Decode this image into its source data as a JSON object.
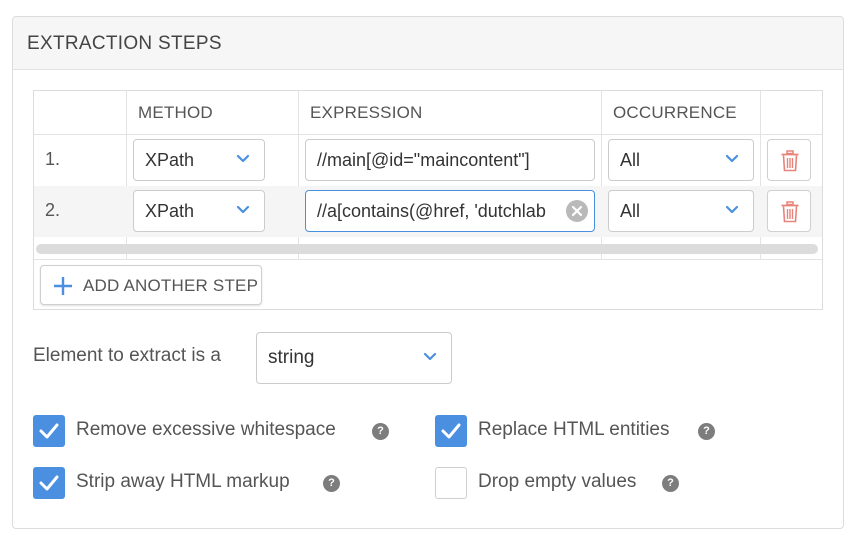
{
  "panel": {
    "title": "EXTRACTION STEPS"
  },
  "table": {
    "headers": {
      "method": "METHOD",
      "expression": "EXPRESSION",
      "occurrence": "OCCURRENCE"
    },
    "rows": [
      {
        "num": "1.",
        "method": "XPath",
        "expression": "//main[@id=\"maincontent\"]",
        "occurrence": "All"
      },
      {
        "num": "2.",
        "method": "XPath",
        "expression": "//a[contains(@href, 'dutchlab",
        "occurrence": "All"
      }
    ],
    "add_button_label": "ADD ANOTHER STEP"
  },
  "extract": {
    "label": "Element to extract is a",
    "type": "string"
  },
  "options": [
    {
      "label": "Remove excessive whitespace",
      "checked": true,
      "help": "?"
    },
    {
      "label": "Replace HTML entities",
      "checked": true,
      "help": "?"
    },
    {
      "label": "Strip away HTML markup",
      "checked": true,
      "help": "?"
    },
    {
      "label": "Drop empty values",
      "checked": false,
      "help": "?"
    }
  ],
  "colors": {
    "accent": "#4a8fe0",
    "trash": "#e8837a",
    "header_bg": "#f6f6f6"
  },
  "icons": [
    "chevron-down-icon",
    "trash-icon",
    "clear-icon",
    "plus-icon",
    "checkmark-icon",
    "help-icon"
  ]
}
